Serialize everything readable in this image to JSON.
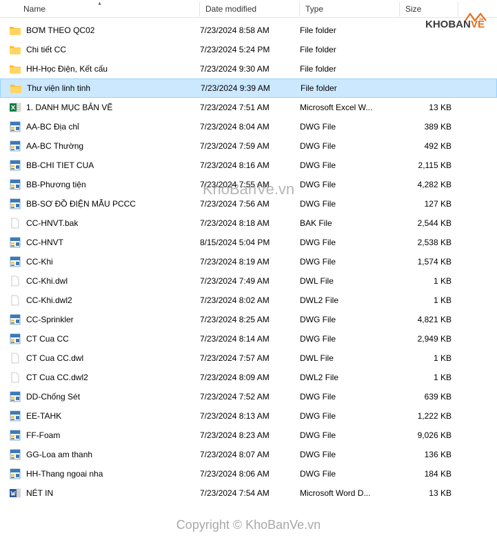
{
  "columns": {
    "name": "Name",
    "date": "Date modified",
    "type": "Type",
    "size": "Size"
  },
  "watermark_center": "KhoBanVe.vn",
  "watermark_bottom": "Copyright © KhoBanVe.vn",
  "logo_text_main": "KHOBAN",
  "logo_text_sub": "VẼ",
  "files": [
    {
      "icon": "folder",
      "name": "BƠM THEO QC02",
      "date": "7/23/2024 8:58 AM",
      "type": "File folder",
      "size": "",
      "selected": false
    },
    {
      "icon": "folder",
      "name": "Chi tiết CC",
      "date": "7/23/2024 5:24 PM",
      "type": "File folder",
      "size": "",
      "selected": false
    },
    {
      "icon": "folder",
      "name": "HH-Học Điện, Kết cấu",
      "date": "7/23/2024 9:30 AM",
      "type": "File folder",
      "size": "",
      "selected": false
    },
    {
      "icon": "folder",
      "name": "Thư viện linh tinh",
      "date": "7/23/2024 9:39 AM",
      "type": "File folder",
      "size": "",
      "selected": true
    },
    {
      "icon": "excel",
      "name": "1. DANH MỤC BẢN VẼ",
      "date": "7/23/2024 7:51 AM",
      "type": "Microsoft Excel W...",
      "size": "13 KB",
      "selected": false
    },
    {
      "icon": "dwg",
      "name": "AA-BC Địa chỉ",
      "date": "7/23/2024 8:04 AM",
      "type": "DWG File",
      "size": "389 KB",
      "selected": false
    },
    {
      "icon": "dwg",
      "name": "AA-BC Thường",
      "date": "7/23/2024 7:59 AM",
      "type": "DWG File",
      "size": "492 KB",
      "selected": false
    },
    {
      "icon": "dwg",
      "name": "BB-CHI TIET CUA",
      "date": "7/23/2024 8:16 AM",
      "type": "DWG File",
      "size": "2,115 KB",
      "selected": false
    },
    {
      "icon": "dwg",
      "name": "BB-Phương tiện",
      "date": "7/23/2024 7:55 AM",
      "type": "DWG File",
      "size": "4,282 KB",
      "selected": false
    },
    {
      "icon": "dwg",
      "name": "BB-SƠ ĐỒ ĐIỆN MẪU PCCC",
      "date": "7/23/2024 7:56 AM",
      "type": "DWG File",
      "size": "127 KB",
      "selected": false
    },
    {
      "icon": "blank",
      "name": "CC-HNVT.bak",
      "date": "7/23/2024 8:18 AM",
      "type": "BAK File",
      "size": "2,544 KB",
      "selected": false
    },
    {
      "icon": "dwg",
      "name": "CC-HNVT",
      "date": "8/15/2024 5:04 PM",
      "type": "DWG File",
      "size": "2,538 KB",
      "selected": false
    },
    {
      "icon": "dwg",
      "name": "CC-Khi",
      "date": "7/23/2024 8:19 AM",
      "type": "DWG File",
      "size": "1,574 KB",
      "selected": false
    },
    {
      "icon": "blank",
      "name": "CC-Khi.dwl",
      "date": "7/23/2024 7:49 AM",
      "type": "DWL File",
      "size": "1 KB",
      "selected": false
    },
    {
      "icon": "blank",
      "name": "CC-Khi.dwl2",
      "date": "7/23/2024 8:02 AM",
      "type": "DWL2 File",
      "size": "1 KB",
      "selected": false
    },
    {
      "icon": "dwg",
      "name": "CC-Sprinkler",
      "date": "7/23/2024 8:25 AM",
      "type": "DWG File",
      "size": "4,821 KB",
      "selected": false
    },
    {
      "icon": "dwg",
      "name": "CT Cua CC",
      "date": "7/23/2024 8:14 AM",
      "type": "DWG File",
      "size": "2,949 KB",
      "selected": false
    },
    {
      "icon": "blank",
      "name": "CT Cua CC.dwl",
      "date": "7/23/2024 7:57 AM",
      "type": "DWL File",
      "size": "1 KB",
      "selected": false
    },
    {
      "icon": "blank",
      "name": "CT Cua CC.dwl2",
      "date": "7/23/2024 8:09 AM",
      "type": "DWL2 File",
      "size": "1 KB",
      "selected": false
    },
    {
      "icon": "dwg",
      "name": "DD-Chống Sét",
      "date": "7/23/2024 7:52 AM",
      "type": "DWG File",
      "size": "639 KB",
      "selected": false
    },
    {
      "icon": "dwg",
      "name": "EE-TAHK",
      "date": "7/23/2024 8:13 AM",
      "type": "DWG File",
      "size": "1,222 KB",
      "selected": false
    },
    {
      "icon": "dwg",
      "name": "FF-Foam",
      "date": "7/23/2024 8:23 AM",
      "type": "DWG File",
      "size": "9,026 KB",
      "selected": false
    },
    {
      "icon": "dwg",
      "name": "GG-Loa am thanh",
      "date": "7/23/2024 8:07 AM",
      "type": "DWG File",
      "size": "136 KB",
      "selected": false
    },
    {
      "icon": "dwg",
      "name": "HH-Thang ngoai nha",
      "date": "7/23/2024 8:06 AM",
      "type": "DWG File",
      "size": "184 KB",
      "selected": false
    },
    {
      "icon": "word",
      "name": "NÉT IN",
      "date": "7/23/2024 7:54 AM",
      "type": "Microsoft Word D...",
      "size": "13 KB",
      "selected": false
    }
  ]
}
